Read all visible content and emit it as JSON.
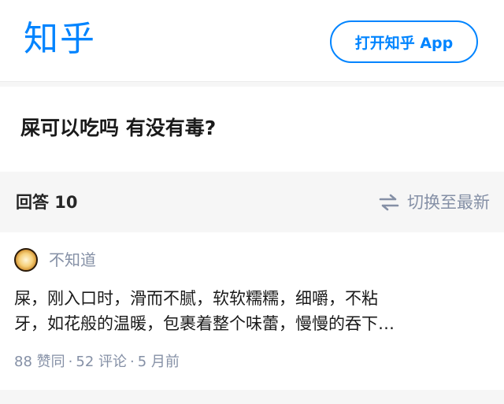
{
  "header": {
    "logo": "知乎",
    "open_app_label": "打开知乎 App"
  },
  "question": {
    "title": "屎可以吃吗 有没有毒?"
  },
  "answers_bar": {
    "count_label": "回答 10",
    "switch_label": "切换至最新",
    "switch_icon": "swap-arrows-icon"
  },
  "answer": {
    "author_name": "不知道",
    "avatar_icon": "avatar",
    "excerpt_lines": [
      "屎，刚入口时，滑而不腻，软软糯糯，细嚼，不粘",
      "牙，如花般的温暖，包裹着整个味蕾，慢慢的吞下…"
    ],
    "votes": "88 赞同",
    "comments": "52 评论",
    "time": "5 月前",
    "separator": "·"
  },
  "colors": {
    "brand_blue": "#0084ff",
    "meta_gray": "#8590a6",
    "page_bg": "#f6f6f6"
  }
}
